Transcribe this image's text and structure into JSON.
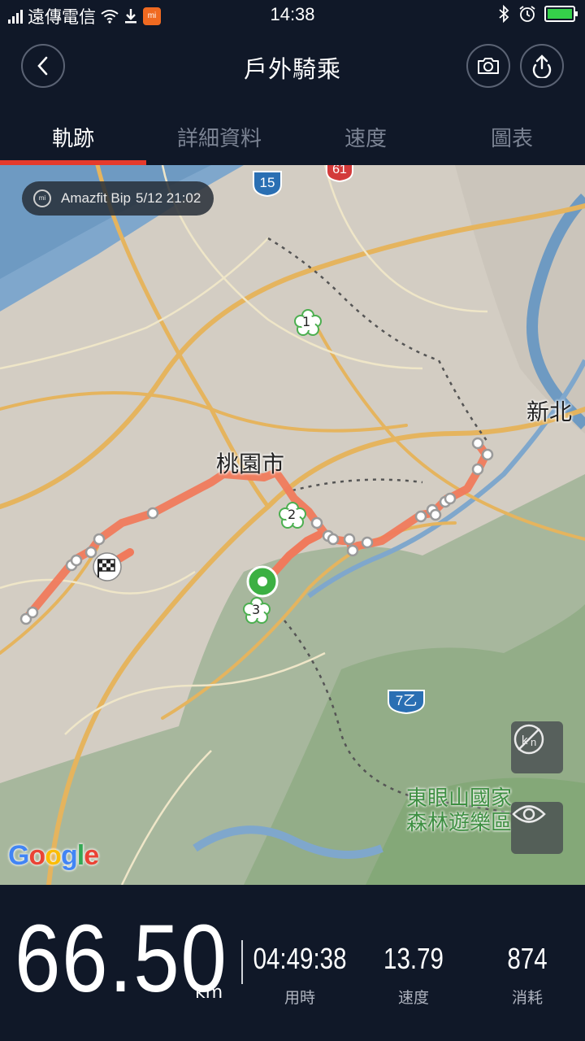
{
  "status_bar": {
    "carrier": "遠傳電信",
    "time": "14:38"
  },
  "header": {
    "title": "戶外騎乘"
  },
  "tabs": [
    {
      "label": "軌跡",
      "active": true
    },
    {
      "label": "詳細資料",
      "active": false
    },
    {
      "label": "速度",
      "active": false
    },
    {
      "label": "圖表",
      "active": false
    }
  ],
  "map": {
    "device": "Amazfit Bip",
    "timestamp": "5/12 21:02",
    "labels": {
      "city": "桃園市",
      "new_taipei": "新北",
      "park_line1": "東眼山國家",
      "park_line2": "森林遊樂區"
    },
    "road_shields": [
      "15",
      "61",
      "7乙"
    ],
    "markers": [
      "1",
      "2",
      "3"
    ],
    "logo": "Google"
  },
  "stats": {
    "distance": "66.50",
    "distance_unit": "km",
    "items": [
      {
        "value": "04:49:38",
        "label": "用時"
      },
      {
        "value": "13.79",
        "label": "速度"
      },
      {
        "value": "874",
        "label": "消耗"
      }
    ]
  },
  "colors": {
    "background": "#101828",
    "accent": "#e53a2c",
    "track": "#f07a5c",
    "start_marker": "#3cb043"
  },
  "icons": [
    "back-icon",
    "camera-icon",
    "share-icon",
    "unit-toggle-icon",
    "eye-icon",
    "finish-flag-icon",
    "start-marker-icon"
  ]
}
